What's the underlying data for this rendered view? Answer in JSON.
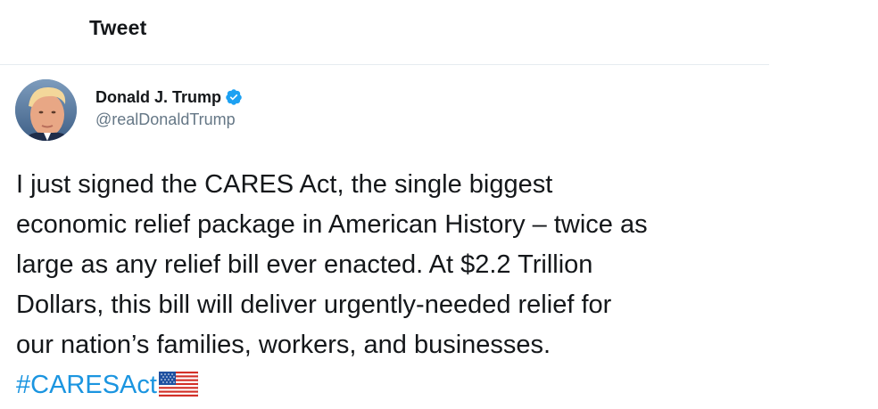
{
  "header": {
    "title": "Tweet"
  },
  "tweet": {
    "author": {
      "name": "Donald J. Trump",
      "handle": "@realDonaldTrump",
      "verified": true,
      "avatar_icon": "profile-photo"
    },
    "text_lines": [
      "I just signed the CARES Act, the single biggest",
      "economic relief package in American History – twice as",
      "large as any relief bill ever enacted. At $2.2 Trillion",
      "Dollars, this bill will deliver urgently-needed relief for",
      "our nation’s families, workers, and businesses."
    ],
    "hashtag": "#CARESAct",
    "emoji": "us-flag"
  },
  "colors": {
    "text": "#14171a",
    "secondary": "#657786",
    "link": "#1b95e0",
    "verified": "#1da1f2",
    "divider": "#e6ecf0"
  }
}
